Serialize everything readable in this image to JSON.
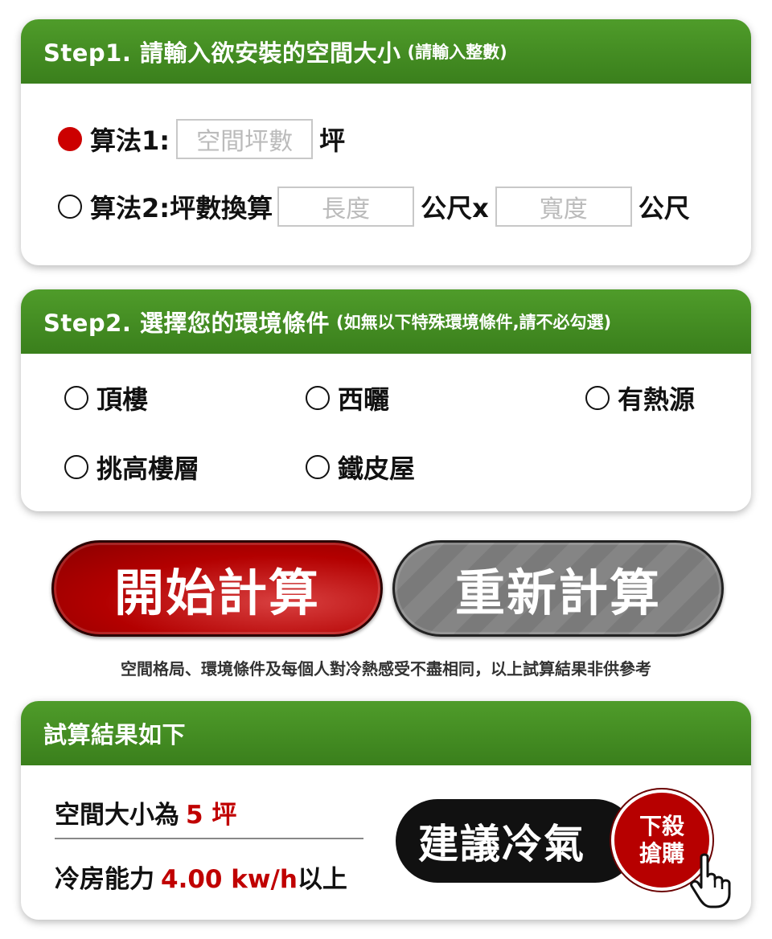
{
  "step1": {
    "title": "Step1. 請輸入欲安裝的空間大小",
    "subtitle": "(請輸入整數)",
    "method1": {
      "label": "算法1:",
      "placeholder": "空間坪數",
      "unit": "坪",
      "selected": true
    },
    "method2": {
      "label": "算法2:坪數換算",
      "length_placeholder": "長度",
      "length_unit": "公尺x",
      "width_placeholder": "寬度",
      "width_unit": "公尺",
      "selected": false
    }
  },
  "step2": {
    "title": "Step2. 選擇您的環境條件",
    "subtitle": "(如無以下特殊環境條件,請不必勾選)",
    "options": [
      {
        "label": "頂樓"
      },
      {
        "label": "西曬"
      },
      {
        "label": "有熱源"
      },
      {
        "label": "挑高樓層"
      },
      {
        "label": "鐵皮屋"
      }
    ]
  },
  "buttons": {
    "start": "開始計算",
    "reset": "重新計算"
  },
  "note": "空間格局、環境條件及每個人對冷熱感受不盡相同，以上試算結果非供參考",
  "result": {
    "title": "試算結果如下",
    "size_label": "空間大小為",
    "size_value": "5 坪",
    "capacity_label": "冷房能力",
    "capacity_value": "4.00 kw/h",
    "capacity_suffix": "以上",
    "suggest_button": "建議冷氣",
    "promo_line1": "下殺",
    "promo_line2": "搶購"
  },
  "colors": {
    "header_green": "#3f8a20",
    "accent_red": "#c00000",
    "button_gray": "#7a7a7a"
  },
  "icons": {
    "pointer": "hand-pointer-icon",
    "radio": "radio-circle-icon"
  }
}
